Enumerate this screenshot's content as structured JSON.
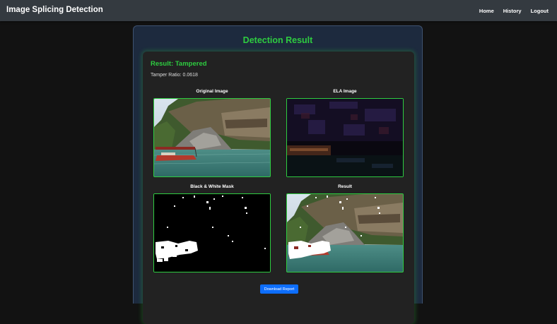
{
  "navbar": {
    "brand": "Image Splicing Detection",
    "links": [
      {
        "label": "Home"
      },
      {
        "label": "History"
      },
      {
        "label": "Logout"
      }
    ]
  },
  "main": {
    "title": "Detection Result",
    "result_label": "Result: Tampered",
    "tamper_ratio": "Tamper Ratio: 0.0618",
    "images": [
      {
        "caption": "Original Image"
      },
      {
        "caption": "ELA Image"
      },
      {
        "caption": "Black & White Mask"
      },
      {
        "caption": "Result"
      }
    ],
    "download_label": "Download Report"
  },
  "colors": {
    "accent": "#2ecc40",
    "button": "#0d6efd",
    "navbar": "#343a40",
    "card": "#1d2a3e"
  }
}
